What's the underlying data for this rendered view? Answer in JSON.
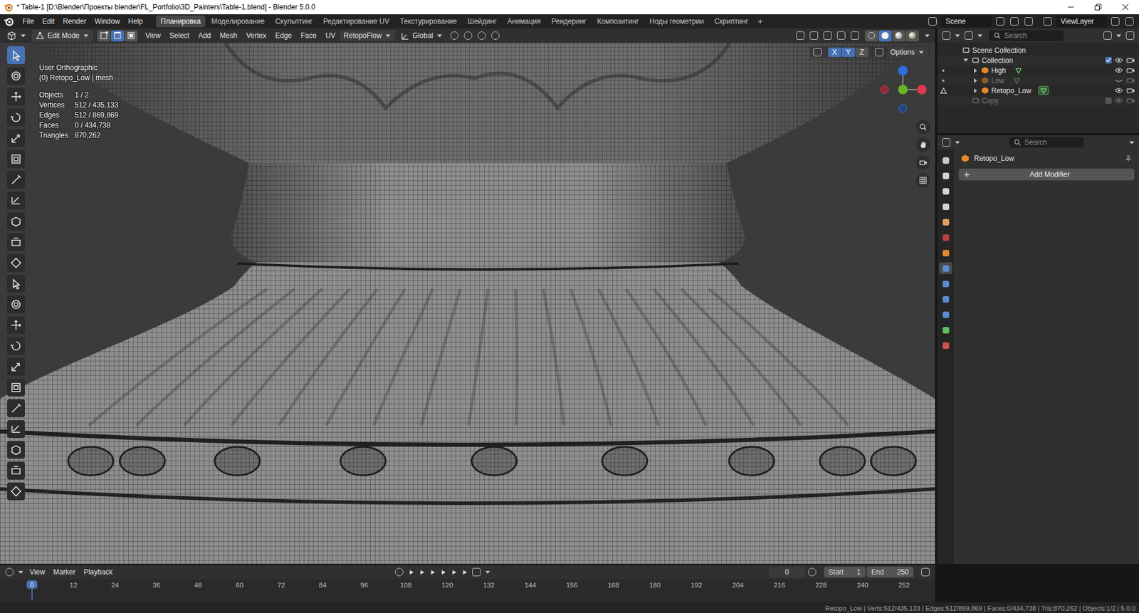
{
  "window": {
    "title": "* Table-1 [D:\\Blender\\Проекты blender\\FL_Portfolio\\3D_Painters\\Table-1.blend] - Blender 5.0.0"
  },
  "menu": [
    "File",
    "Edit",
    "Render",
    "Window",
    "Help"
  ],
  "workspaces": [
    {
      "label": "Планировка",
      "selected": true
    },
    {
      "label": "Моделирование",
      "selected": false
    },
    {
      "label": "Скульптинг",
      "selected": false
    },
    {
      "label": "Редактирование UV",
      "selected": false
    },
    {
      "label": "Текстурирование",
      "selected": false
    },
    {
      "label": "Шейдинг",
      "selected": false
    },
    {
      "label": "Анимация",
      "selected": false
    },
    {
      "label": "Рендеринг",
      "selected": false
    },
    {
      "label": "Композитинг",
      "selected": false
    },
    {
      "label": "Ноды геометрии",
      "selected": false
    },
    {
      "label": "Скриптинг",
      "selected": false
    }
  ],
  "add_workspace": "+",
  "scene": "Scene",
  "view_layer": "ViewLayer",
  "viewport_header": {
    "mode": "Edit Mode",
    "select_modes": [
      {
        "selected": false
      },
      {
        "selected": true
      },
      {
        "selected": false
      }
    ],
    "menus": [
      "View",
      "Select",
      "Add",
      "Mesh",
      "Vertex",
      "Edge",
      "Face",
      "UV"
    ],
    "addon_menu": "RetopoFlow",
    "orientation": "Global",
    "shading": [
      {
        "selected": false
      },
      {
        "selected": true
      },
      {
        "selected": false
      },
      {
        "selected": false
      }
    ]
  },
  "overlay": {
    "view": "User Orthographic",
    "context": "(0) Retopo_Low | mesh",
    "stats": [
      {
        "label": "Objects",
        "value": "1 / 2"
      },
      {
        "label": "Vertices",
        "value": "512 / 435,133"
      },
      {
        "label": "Edges",
        "value": "512 / 869,869"
      },
      {
        "label": "Faces",
        "value": "0 / 434,738"
      },
      {
        "label": "Triangles",
        "value": "870,262"
      }
    ]
  },
  "mirror": {
    "axes": [
      {
        "label": "X",
        "selected": true
      },
      {
        "label": "Y",
        "selected": true
      },
      {
        "label": "Z",
        "selected": false
      }
    ],
    "options": "Options"
  },
  "toolbar": [
    {
      "selected": true
    },
    {
      "selected": false
    },
    {
      "selected": false
    },
    {
      "selected": false
    },
    {
      "selected": false
    },
    {
      "selected": false
    },
    {
      "selected": false
    },
    {
      "selected": false
    },
    {
      "selected": false
    },
    {
      "selected": false
    },
    {
      "selected": false
    },
    {
      "selected": false
    },
    {
      "selected": false
    },
    {
      "selected": false
    },
    {
      "selected": false
    },
    {
      "selected": false
    },
    {
      "selected": false
    },
    {
      "selected": false
    },
    {
      "selected": false
    },
    {
      "selected": false
    },
    {
      "selected": false
    },
    {
      "selected": false
    }
  ],
  "outliner": {
    "search": "Search",
    "items": [
      {
        "name": "Scene Collection",
        "depth": 0,
        "kind": "scene",
        "expandable": false,
        "expanded": false,
        "checked": false,
        "visible": true,
        "dimmed": false,
        "editing": false,
        "data_active": false
      },
      {
        "name": "Collection",
        "depth": 1,
        "kind": "collection",
        "expandable": true,
        "expanded": true,
        "checked": true,
        "visible": true,
        "dimmed": false,
        "editing": false,
        "data_active": false
      },
      {
        "name": "High",
        "depth": 2,
        "kind": "object",
        "expandable": true,
        "expanded": false,
        "checked": false,
        "visible": true,
        "dimmed": false,
        "editing": false,
        "data_active": false
      },
      {
        "name": "Low",
        "depth": 2,
        "kind": "object",
        "expandable": true,
        "expanded": false,
        "checked": false,
        "visible": false,
        "dimmed": true,
        "editing": false,
        "data_active": false
      },
      {
        "name": "Retopo_Low",
        "depth": 2,
        "kind": "object",
        "expandable": true,
        "expanded": false,
        "checked": false,
        "visible": true,
        "dimmed": false,
        "editing": true,
        "data_active": true
      },
      {
        "name": "Copy",
        "depth": 1,
        "kind": "collection",
        "expandable": false,
        "expanded": false,
        "checked": false,
        "visible": true,
        "dimmed": true,
        "editing": false,
        "data_active": false
      }
    ]
  },
  "properties": {
    "search": "Search",
    "object": "Retopo_Low",
    "add_modifier": "Add Modifier",
    "tabs": [
      {
        "selected": false
      },
      {
        "selected": false
      },
      {
        "selected": false
      },
      {
        "selected": false
      },
      {
        "selected": false
      },
      {
        "selected": false
      },
      {
        "selected": false
      },
      {
        "selected": true
      },
      {
        "selected": false
      },
      {
        "selected": false
      },
      {
        "selected": false
      },
      {
        "selected": false
      },
      {
        "selected": false
      }
    ]
  },
  "timeline": {
    "menus": [
      "View",
      "Marker",
      "Playback"
    ],
    "frame_field": "0",
    "start_label": "Start",
    "start": "1",
    "end_label": "End",
    "end": "250",
    "playhead": "0",
    "ticks": [
      "12",
      "24",
      "36",
      "48",
      "60",
      "72",
      "84",
      "96",
      "108",
      "120",
      "132",
      "144",
      "156",
      "168",
      "180",
      "192",
      "204",
      "216",
      "228",
      "240",
      "252"
    ]
  },
  "status_bar": "Retopo_Low | Verts:512/435,133 | Edges:512/869,869 | Faces:0/434,738 | Tris:870,262 | Objects:1/2 | 5.0.0"
}
